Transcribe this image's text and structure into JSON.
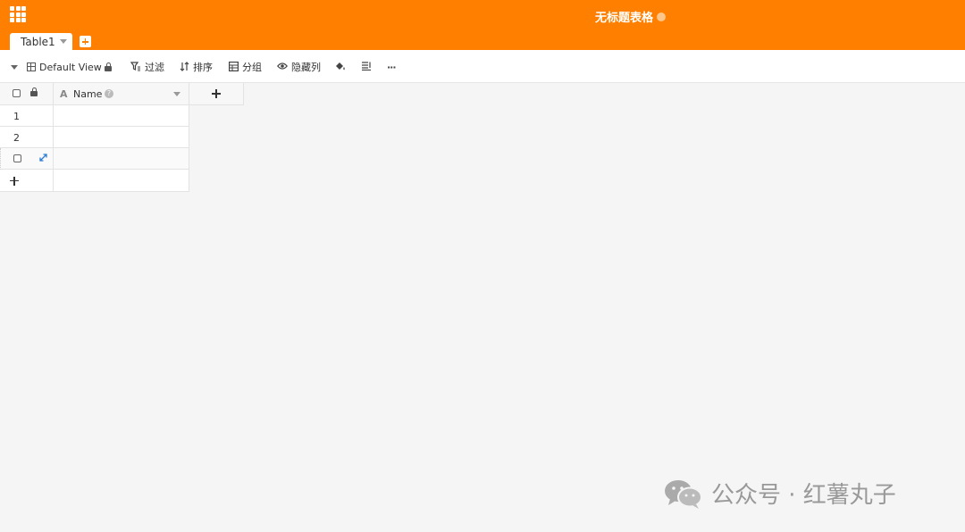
{
  "header": {
    "title": "无标题表格"
  },
  "tabs": [
    {
      "label": "Table1"
    }
  ],
  "toolbar": {
    "view_name": "Default View",
    "filter_label": "过滤",
    "sort_label": "排序",
    "group_label": "分组",
    "hide_columns_label": "隐藏列",
    "more_icon": "···"
  },
  "grid": {
    "columns": [
      {
        "name": "Name",
        "type_icon": "A"
      }
    ],
    "rows": [
      {
        "index": "1",
        "name": ""
      },
      {
        "index": "2",
        "name": ""
      }
    ]
  },
  "watermark": {
    "text": "公众号 · 红薯丸子"
  },
  "colors": {
    "brand": "#ff8000",
    "background": "#f5f5f5",
    "selection_accent": "#2a7bd3"
  }
}
